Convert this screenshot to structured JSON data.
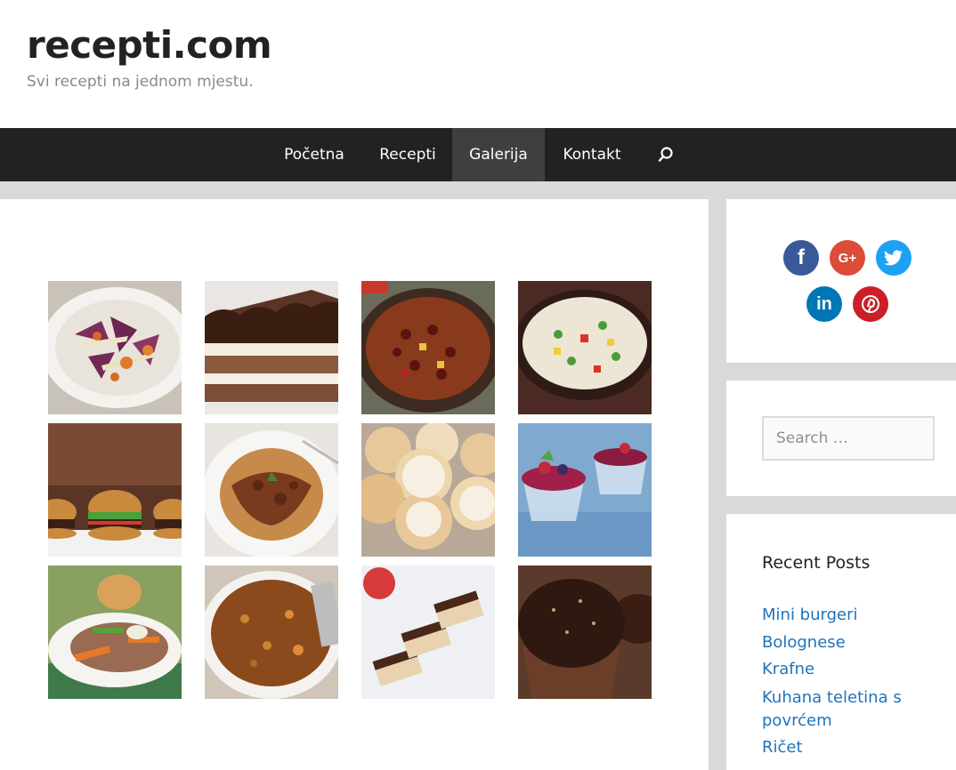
{
  "header": {
    "title": "recepti.com",
    "description": "Svi recepti na jednom mjestu."
  },
  "nav": {
    "items": [
      {
        "label": "Početna",
        "active": false
      },
      {
        "label": "Recepti",
        "active": false
      },
      {
        "label": "Galerija",
        "active": true
      },
      {
        "label": "Kontakt",
        "active": false
      }
    ],
    "search_icon": "search-icon"
  },
  "gallery": {
    "items": [
      "salad-photo",
      "chocolate-cake-photo",
      "chili-beans-photo",
      "rice-vegetables-photo",
      "mini-burgers-photo",
      "bolognese-photo",
      "krafne-photo",
      "berry-dessert-photo",
      "veal-vegetables-photo",
      "lentil-stew-photo",
      "chocolate-bars-photo",
      "chocolate-cupcake-photo"
    ]
  },
  "social": {
    "buttons": [
      {
        "name": "facebook-icon",
        "glyph": "f",
        "color": "#3b5998"
      },
      {
        "name": "google-plus-icon",
        "glyph": "G+",
        "color": "#dd4b39"
      },
      {
        "name": "twitter-icon",
        "glyph": "t",
        "color": "#1da1f2"
      },
      {
        "name": "linkedin-icon",
        "glyph": "in",
        "color": "#0077b5"
      },
      {
        "name": "pinterest-icon",
        "glyph": "p",
        "color": "#cb2027"
      }
    ]
  },
  "search": {
    "placeholder": "Search …"
  },
  "recent_posts": {
    "title": "Recent Posts",
    "items": [
      "Mini burgeri",
      "Bolognese",
      "Krafne",
      "Kuhana teletina s povrćem",
      "Ričet"
    ]
  },
  "colors": {
    "nav_bg": "#222222",
    "nav_active": "#3f3f3f",
    "link": "#1e73be",
    "page_bg": "#d9d9d9"
  }
}
